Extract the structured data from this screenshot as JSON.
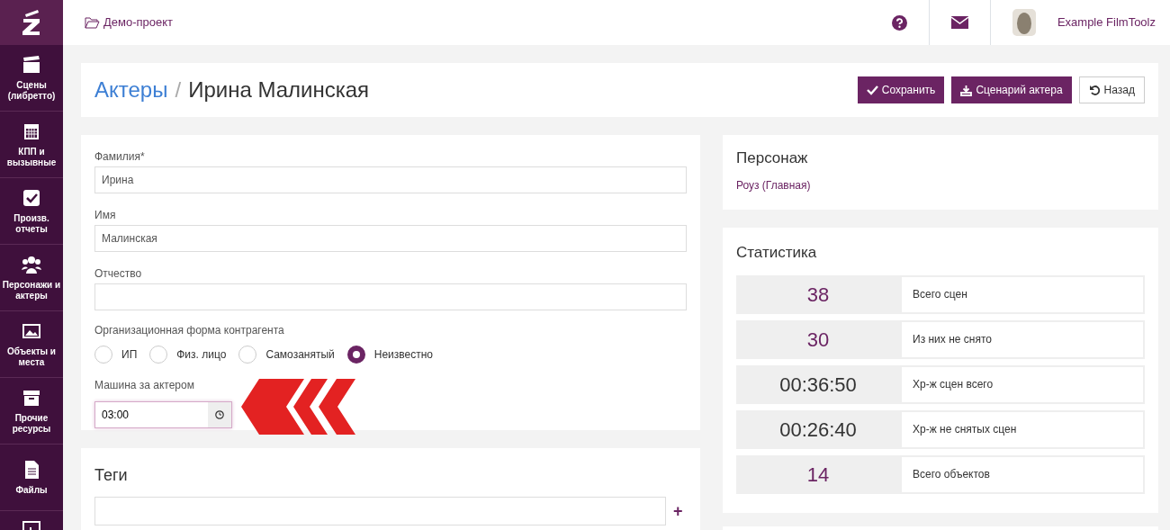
{
  "sidebar": {
    "items": [
      {
        "label": "Сцены (либретто)"
      },
      {
        "label": "КПП и вызывные"
      },
      {
        "label": "Произв. отчеты"
      },
      {
        "label": "Персонажи и актеры"
      },
      {
        "label": "Объекты и места"
      },
      {
        "label": "Прочие ресурсы"
      },
      {
        "label": "Файлы"
      }
    ]
  },
  "topbar": {
    "project": "Демо-проект",
    "user": "Example FilmToolz"
  },
  "header": {
    "breadcrumb": "Актеры",
    "separator": "/",
    "title": "Ирина Малинская",
    "buttons": [
      {
        "label": "Сохранить",
        "kind": "primary"
      },
      {
        "label": "Сценарий актера",
        "kind": "primary"
      },
      {
        "label": "Назад",
        "kind": "secondary"
      }
    ]
  },
  "form": {
    "fields": [
      {
        "label": "Фамилия*",
        "value": "Ирина"
      },
      {
        "label": "Имя",
        "value": "Малинская"
      },
      {
        "label": "Отчество"
      }
    ],
    "org_form": {
      "label": "Организационная форма контрагента",
      "options": [
        {
          "label": "ИП",
          "selected": false
        },
        {
          "label": "Физ. лицо",
          "selected": false
        },
        {
          "label": "Самозанятый",
          "selected": false
        },
        {
          "label": "Неизвестно",
          "selected": true
        }
      ]
    },
    "car": {
      "label": "Машина за актером",
      "value": "03:00"
    }
  },
  "tags": {
    "title": "Теги",
    "add": "+"
  },
  "character": {
    "title": "Персонаж",
    "link": "Роуз (Главная)"
  },
  "stats": {
    "title": "Статистика",
    "rows": [
      {
        "value": "38",
        "label": "Всего сцен",
        "kind": "count"
      },
      {
        "value": "30",
        "label": "Из них не снято",
        "kind": "count"
      },
      {
        "value": "00:36:50",
        "label": "Хр-ж сцен всего",
        "kind": "duration"
      },
      {
        "value": "00:26:40",
        "label": "Хр-ж не снятых сцен",
        "kind": "duration"
      },
      {
        "value": "14",
        "label": "Всего объектов",
        "kind": "count"
      }
    ]
  }
}
